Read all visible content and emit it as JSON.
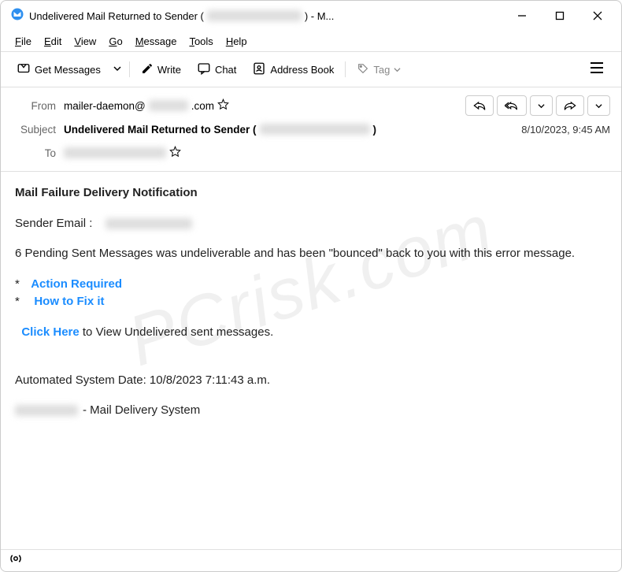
{
  "window": {
    "title_prefix": "Undelivered Mail Returned to Sender (",
    "title_suffix": ") - M..."
  },
  "menu": {
    "file": "File",
    "edit": "Edit",
    "view": "View",
    "go": "Go",
    "message": "Message",
    "tools": "Tools",
    "help": "Help"
  },
  "toolbar": {
    "get_messages": "Get Messages",
    "write": "Write",
    "chat": "Chat",
    "address_book": "Address Book",
    "tag": "Tag"
  },
  "headers": {
    "from_label": "From",
    "from_prefix": "mailer-daemon@",
    "from_suffix": ".com",
    "subject_label": "Subject",
    "subject_prefix": "Undelivered Mail Returned to Sender (",
    "subject_suffix": ")",
    "to_label": "To",
    "timestamp": "8/10/2023, 9:45 AM"
  },
  "body": {
    "title": "Mail Failure Delivery Notification",
    "sender_label": "Sender Email :",
    "main_text": "6  Pending Sent Messages was undeliverable and has been \"bounced\" back to you with this error message.",
    "bullet_1": "Action Required",
    "bullet_2": "How to Fix it",
    "click_here": "Click Here",
    "click_suffix": "  to View Undelivered sent messages.",
    "auto_date": "Automated System Date: 10/8/2023 7:11:43 a.m.",
    "system_suffix": " - Mail Delivery System"
  },
  "watermark": "PCrisk.com"
}
